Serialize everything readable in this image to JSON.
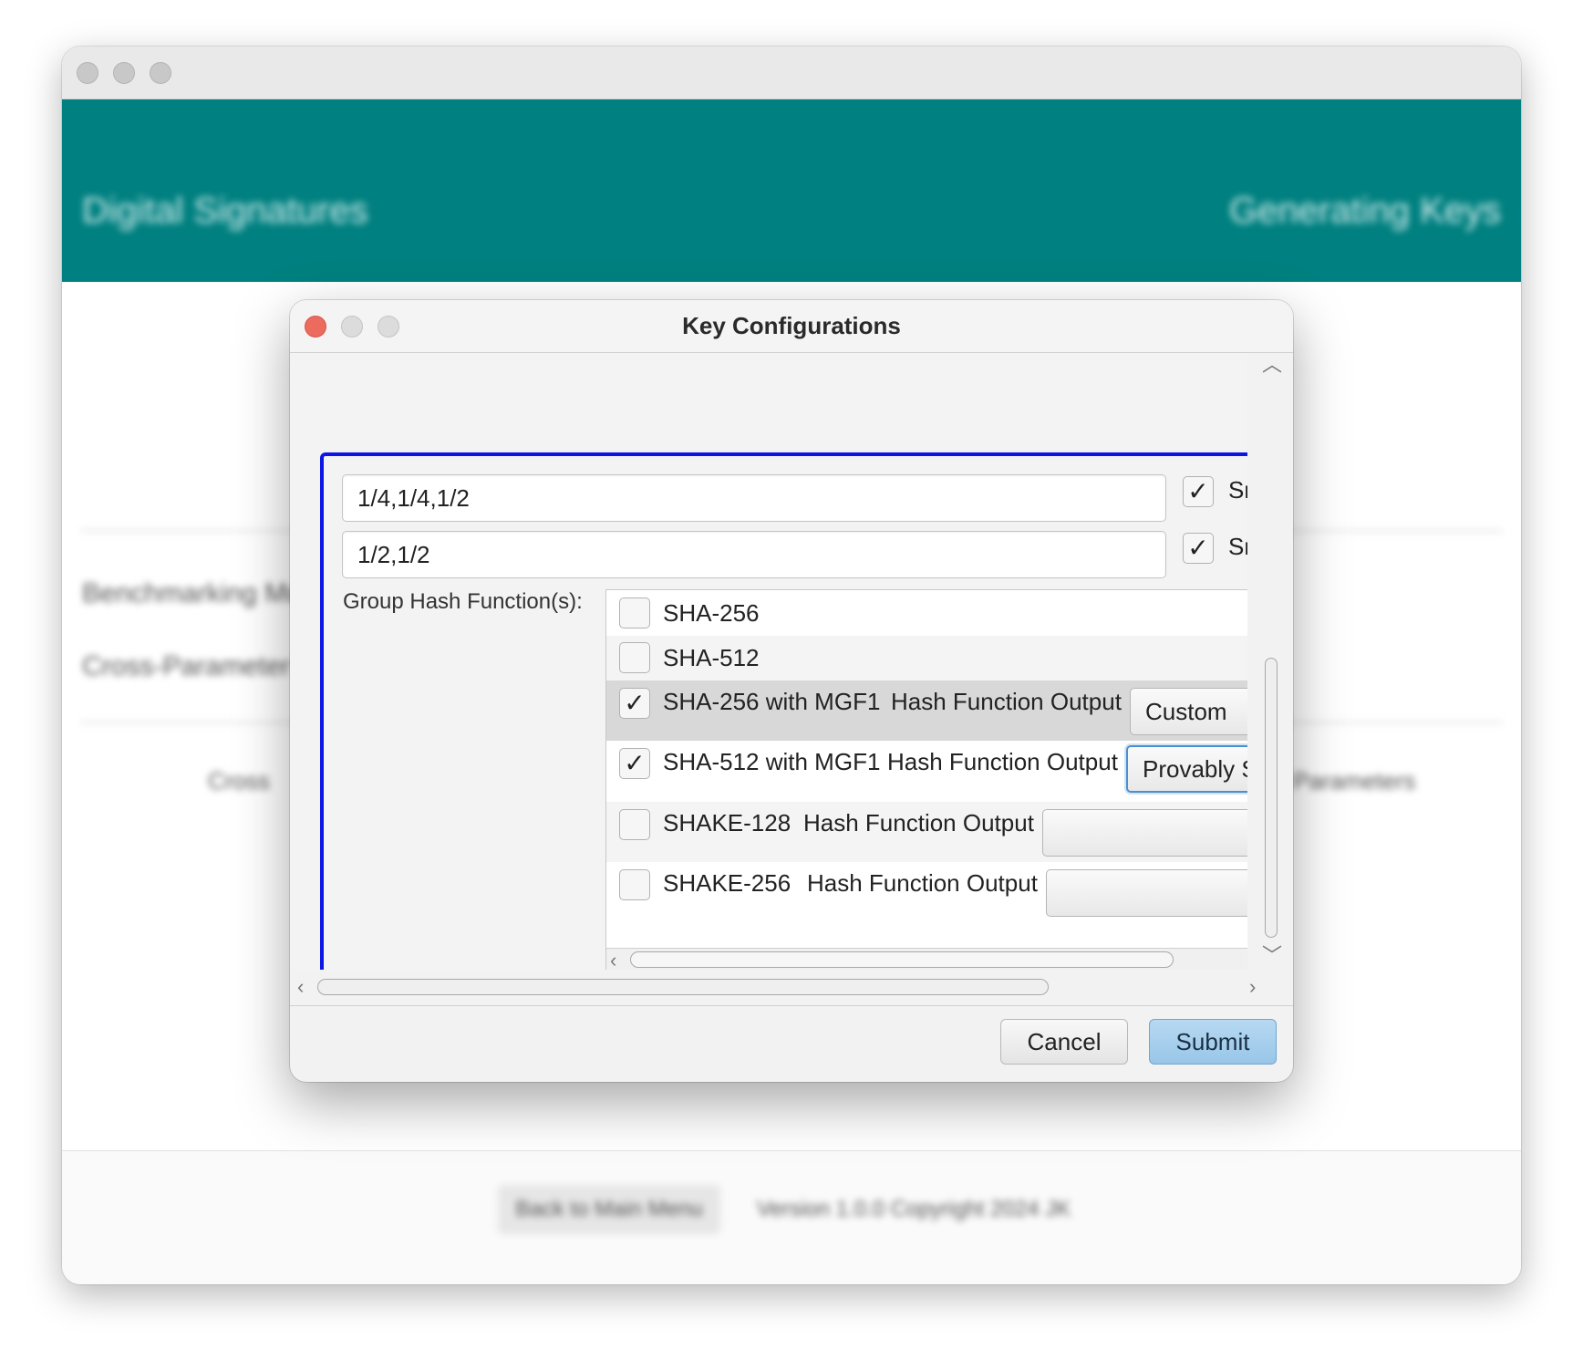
{
  "app": {
    "header_title": "Digital Signatures",
    "header_right": "Generating Keys",
    "row_label_1": "Benchmarking Mode",
    "row_label_2": "Cross-Parameter Benchmarking",
    "row_center_left": "Cross",
    "row_center_right": "Parameters",
    "back_button": "Back to Main Menu",
    "version": "Version 1.0.0 Copyright 2024 JK"
  },
  "dialog": {
    "title": "Key Configurations",
    "field1_value": "1/4,1/4,1/2",
    "field1_checkbox_label": "Sm",
    "field1_checked": true,
    "field2_value": "1/2,1/2",
    "field2_checkbox_label": "Sm",
    "field2_checked": true,
    "group_hash_label": "Group Hash Function(s):",
    "hash_functions": [
      {
        "name": "SHA-256",
        "checked": false
      },
      {
        "name": "SHA-512",
        "checked": false
      },
      {
        "name": "SHA-256 with MGF1",
        "checked": true,
        "output_label": "Hash Function Output",
        "output_value": "Custom"
      },
      {
        "name": "SHA-512 with MGF1",
        "checked": true,
        "output_label": "Hash Function Output",
        "output_value": "Provably Se"
      },
      {
        "name": "SHAKE-128",
        "checked": false,
        "output_label": "Hash Function Output",
        "output_value": ""
      },
      {
        "name": "SHAKE-256",
        "checked": false,
        "output_label": "Hash Function Output",
        "output_value": ""
      }
    ],
    "cancel_label": "Cancel",
    "submit_label": "Submit"
  },
  "icons": {
    "check": "✓",
    "arrow_up": "chevron-up-icon",
    "arrow_down": "chevron-down-icon",
    "arrow_left": "chevron-left-icon",
    "arrow_right": "chevron-right-icon"
  },
  "colors": {
    "header": "#008080",
    "focus_border": "#0b16e6",
    "close_light": "#ed6a5e",
    "submit": "#a7cfee"
  }
}
